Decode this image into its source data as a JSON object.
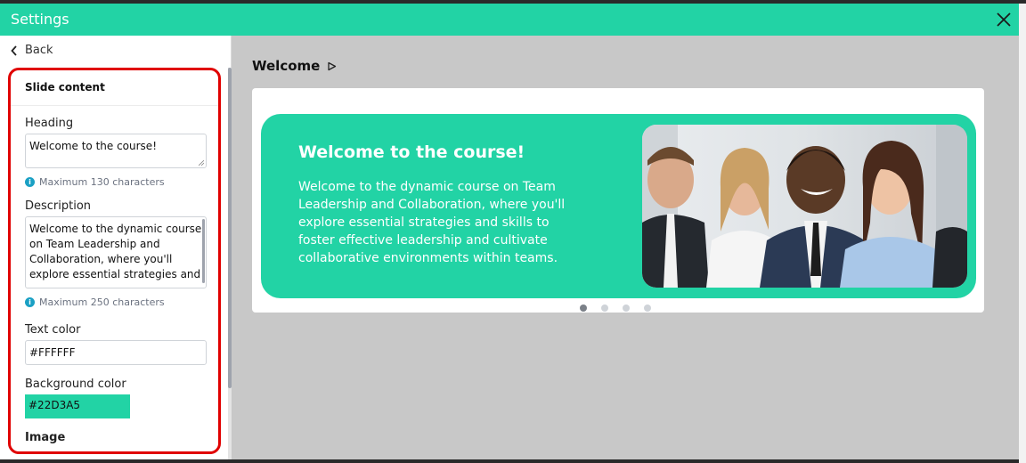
{
  "window": {
    "title": "Settings"
  },
  "nav": {
    "back_label": "Back"
  },
  "panel": {
    "section_title": "Slide content",
    "heading": {
      "label": "Heading",
      "value": "Welcome to the course!",
      "hint": "Maximum 130 characters"
    },
    "description": {
      "label": "Description",
      "value": "Welcome to the dynamic course on Team Leadership and Collaboration, where you'll explore essential strategies and",
      "hint": "Maximum 250 characters"
    },
    "text_color": {
      "label": "Text color",
      "value": "#FFFFFF"
    },
    "background_color": {
      "label": "Background color",
      "value": "#22D3A5"
    },
    "image": {
      "label": "Image"
    }
  },
  "preview": {
    "slide_title": "Welcome",
    "heading": "Welcome to the course!",
    "description": "Welcome to the dynamic course on Team Leadership and Collaboration, where you'll explore essential strategies and skills to foster effective leadership and cultivate collaborative environments within teams.",
    "pager": {
      "count": 4,
      "active": 0
    }
  },
  "colors": {
    "accent": "#22d3a5",
    "text": "#ffffff",
    "highlight": "#e00000"
  },
  "icons": {
    "close": "close-icon",
    "back": "chevron-left-icon",
    "play": "play-icon",
    "info": "info-icon"
  }
}
